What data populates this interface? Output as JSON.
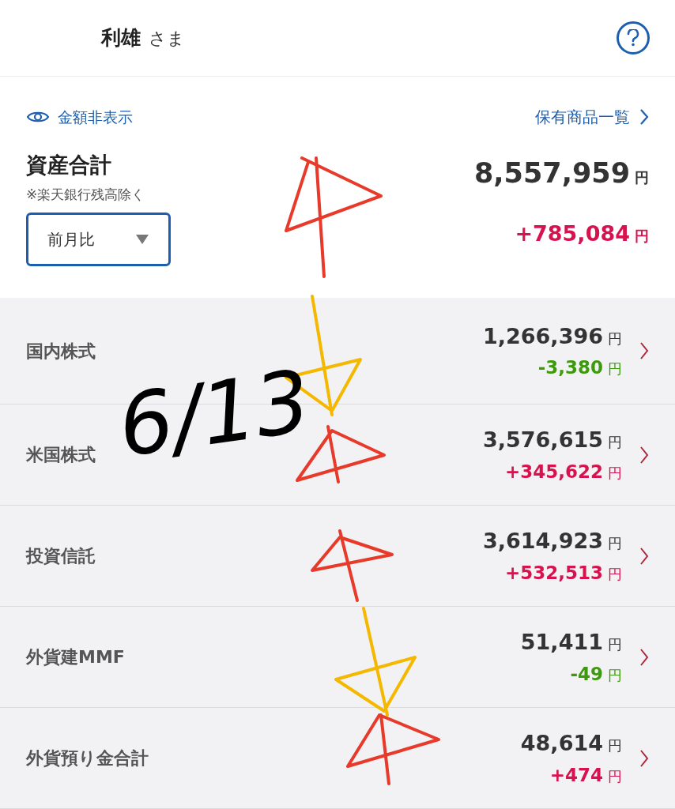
{
  "header": {
    "name": "利雄",
    "honorific": "さま"
  },
  "summary": {
    "hide_amounts": "金額非表示",
    "holdings_link": "保有商品一覧",
    "total_label": "資産合計",
    "note": "※楽天銀行残高除く",
    "period_select": "前月比",
    "total": "8,557,959",
    "total_currency": "円",
    "change": "+785,084",
    "change_currency": "円",
    "color": "#d7134f"
  },
  "rows": [
    {
      "label": "国内株式",
      "value": "1,266,396",
      "value_currency": "円",
      "change": "-3,380",
      "change_currency": "円",
      "color": "#3d9a0c"
    },
    {
      "label": "米国株式",
      "value": "3,576,615",
      "value_currency": "円",
      "change": "+345,622",
      "change_currency": "円",
      "color": "#d7134f"
    },
    {
      "label": "投資信託",
      "value": "3,614,923",
      "value_currency": "円",
      "change": "+532,513",
      "change_currency": "円",
      "color": "#d7134f"
    },
    {
      "label": "外貨建MMF",
      "value": "51,411",
      "value_currency": "円",
      "change": "-49",
      "change_currency": "円",
      "color": "#3d9a0c"
    },
    {
      "label": "外貨預り金合計",
      "value": "48,614",
      "value_currency": "円",
      "change": "+474",
      "change_currency": "円",
      "color": "#d7134f"
    }
  ],
  "annotation": {
    "handwritten_date": "6/13"
  }
}
